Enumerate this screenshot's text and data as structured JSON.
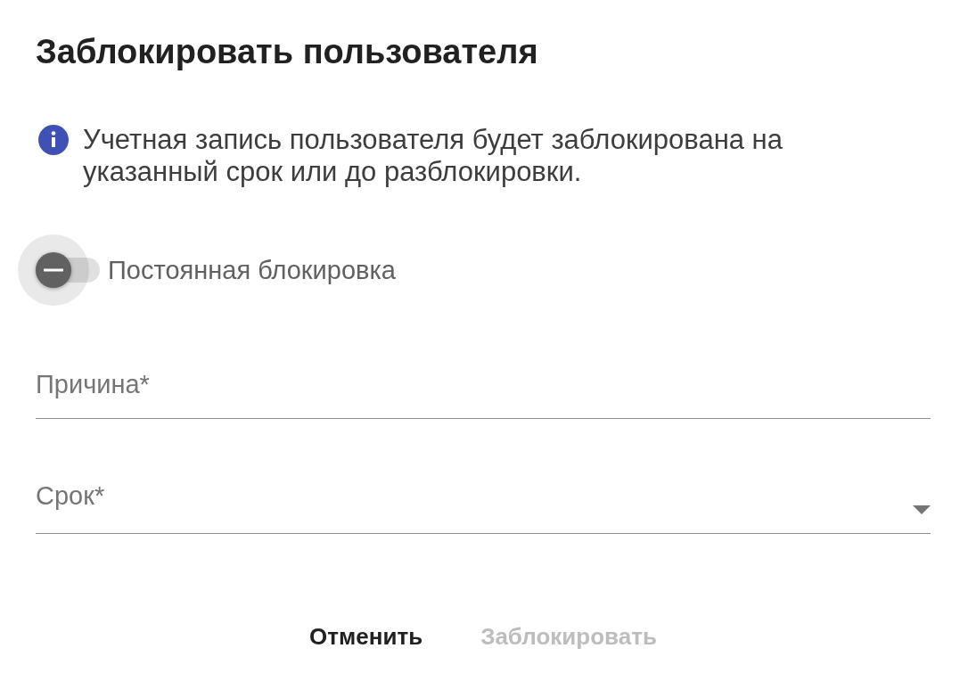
{
  "dialog": {
    "title": "Заблокировать пользователя",
    "info": {
      "text": "Учетная запись пользователя будет заблокирована на указанный срок или до разблокировки."
    },
    "toggle": {
      "label": "Постоянная блокировка",
      "on": false,
      "focused": true
    },
    "fields": [
      {
        "kind": "text",
        "placeholder": "Причина*"
      },
      {
        "kind": "select",
        "placeholder": "Срок*"
      }
    ],
    "buttons": [
      {
        "label": "Отменить",
        "disabled": false
      },
      {
        "label": "Заблокировать",
        "disabled": true
      }
    ]
  }
}
